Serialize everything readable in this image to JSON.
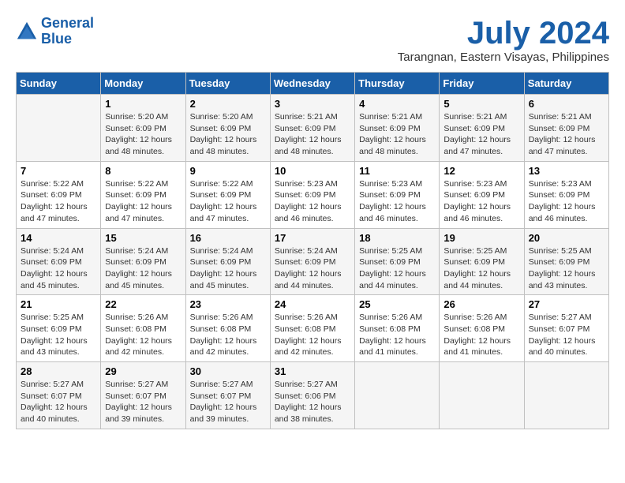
{
  "logo": {
    "line1": "General",
    "line2": "Blue"
  },
  "title": "July 2024",
  "location": "Tarangnan, Eastern Visayas, Philippines",
  "headers": [
    "Sunday",
    "Monday",
    "Tuesday",
    "Wednesday",
    "Thursday",
    "Friday",
    "Saturday"
  ],
  "weeks": [
    [
      {
        "day": "",
        "info": ""
      },
      {
        "day": "1",
        "info": "Sunrise: 5:20 AM\nSunset: 6:09 PM\nDaylight: 12 hours\nand 48 minutes."
      },
      {
        "day": "2",
        "info": "Sunrise: 5:20 AM\nSunset: 6:09 PM\nDaylight: 12 hours\nand 48 minutes."
      },
      {
        "day": "3",
        "info": "Sunrise: 5:21 AM\nSunset: 6:09 PM\nDaylight: 12 hours\nand 48 minutes."
      },
      {
        "day": "4",
        "info": "Sunrise: 5:21 AM\nSunset: 6:09 PM\nDaylight: 12 hours\nand 48 minutes."
      },
      {
        "day": "5",
        "info": "Sunrise: 5:21 AM\nSunset: 6:09 PM\nDaylight: 12 hours\nand 47 minutes."
      },
      {
        "day": "6",
        "info": "Sunrise: 5:21 AM\nSunset: 6:09 PM\nDaylight: 12 hours\nand 47 minutes."
      }
    ],
    [
      {
        "day": "7",
        "info": "Sunrise: 5:22 AM\nSunset: 6:09 PM\nDaylight: 12 hours\nand 47 minutes."
      },
      {
        "day": "8",
        "info": "Sunrise: 5:22 AM\nSunset: 6:09 PM\nDaylight: 12 hours\nand 47 minutes."
      },
      {
        "day": "9",
        "info": "Sunrise: 5:22 AM\nSunset: 6:09 PM\nDaylight: 12 hours\nand 47 minutes."
      },
      {
        "day": "10",
        "info": "Sunrise: 5:23 AM\nSunset: 6:09 PM\nDaylight: 12 hours\nand 46 minutes."
      },
      {
        "day": "11",
        "info": "Sunrise: 5:23 AM\nSunset: 6:09 PM\nDaylight: 12 hours\nand 46 minutes."
      },
      {
        "day": "12",
        "info": "Sunrise: 5:23 AM\nSunset: 6:09 PM\nDaylight: 12 hours\nand 46 minutes."
      },
      {
        "day": "13",
        "info": "Sunrise: 5:23 AM\nSunset: 6:09 PM\nDaylight: 12 hours\nand 46 minutes."
      }
    ],
    [
      {
        "day": "14",
        "info": "Sunrise: 5:24 AM\nSunset: 6:09 PM\nDaylight: 12 hours\nand 45 minutes."
      },
      {
        "day": "15",
        "info": "Sunrise: 5:24 AM\nSunset: 6:09 PM\nDaylight: 12 hours\nand 45 minutes."
      },
      {
        "day": "16",
        "info": "Sunrise: 5:24 AM\nSunset: 6:09 PM\nDaylight: 12 hours\nand 45 minutes."
      },
      {
        "day": "17",
        "info": "Sunrise: 5:24 AM\nSunset: 6:09 PM\nDaylight: 12 hours\nand 44 minutes."
      },
      {
        "day": "18",
        "info": "Sunrise: 5:25 AM\nSunset: 6:09 PM\nDaylight: 12 hours\nand 44 minutes."
      },
      {
        "day": "19",
        "info": "Sunrise: 5:25 AM\nSunset: 6:09 PM\nDaylight: 12 hours\nand 44 minutes."
      },
      {
        "day": "20",
        "info": "Sunrise: 5:25 AM\nSunset: 6:09 PM\nDaylight: 12 hours\nand 43 minutes."
      }
    ],
    [
      {
        "day": "21",
        "info": "Sunrise: 5:25 AM\nSunset: 6:09 PM\nDaylight: 12 hours\nand 43 minutes."
      },
      {
        "day": "22",
        "info": "Sunrise: 5:26 AM\nSunset: 6:08 PM\nDaylight: 12 hours\nand 42 minutes."
      },
      {
        "day": "23",
        "info": "Sunrise: 5:26 AM\nSunset: 6:08 PM\nDaylight: 12 hours\nand 42 minutes."
      },
      {
        "day": "24",
        "info": "Sunrise: 5:26 AM\nSunset: 6:08 PM\nDaylight: 12 hours\nand 42 minutes."
      },
      {
        "day": "25",
        "info": "Sunrise: 5:26 AM\nSunset: 6:08 PM\nDaylight: 12 hours\nand 41 minutes."
      },
      {
        "day": "26",
        "info": "Sunrise: 5:26 AM\nSunset: 6:08 PM\nDaylight: 12 hours\nand 41 minutes."
      },
      {
        "day": "27",
        "info": "Sunrise: 5:27 AM\nSunset: 6:07 PM\nDaylight: 12 hours\nand 40 minutes."
      }
    ],
    [
      {
        "day": "28",
        "info": "Sunrise: 5:27 AM\nSunset: 6:07 PM\nDaylight: 12 hours\nand 40 minutes."
      },
      {
        "day": "29",
        "info": "Sunrise: 5:27 AM\nSunset: 6:07 PM\nDaylight: 12 hours\nand 39 minutes."
      },
      {
        "day": "30",
        "info": "Sunrise: 5:27 AM\nSunset: 6:07 PM\nDaylight: 12 hours\nand 39 minutes."
      },
      {
        "day": "31",
        "info": "Sunrise: 5:27 AM\nSunset: 6:06 PM\nDaylight: 12 hours\nand 38 minutes."
      },
      {
        "day": "",
        "info": ""
      },
      {
        "day": "",
        "info": ""
      },
      {
        "day": "",
        "info": ""
      }
    ]
  ]
}
